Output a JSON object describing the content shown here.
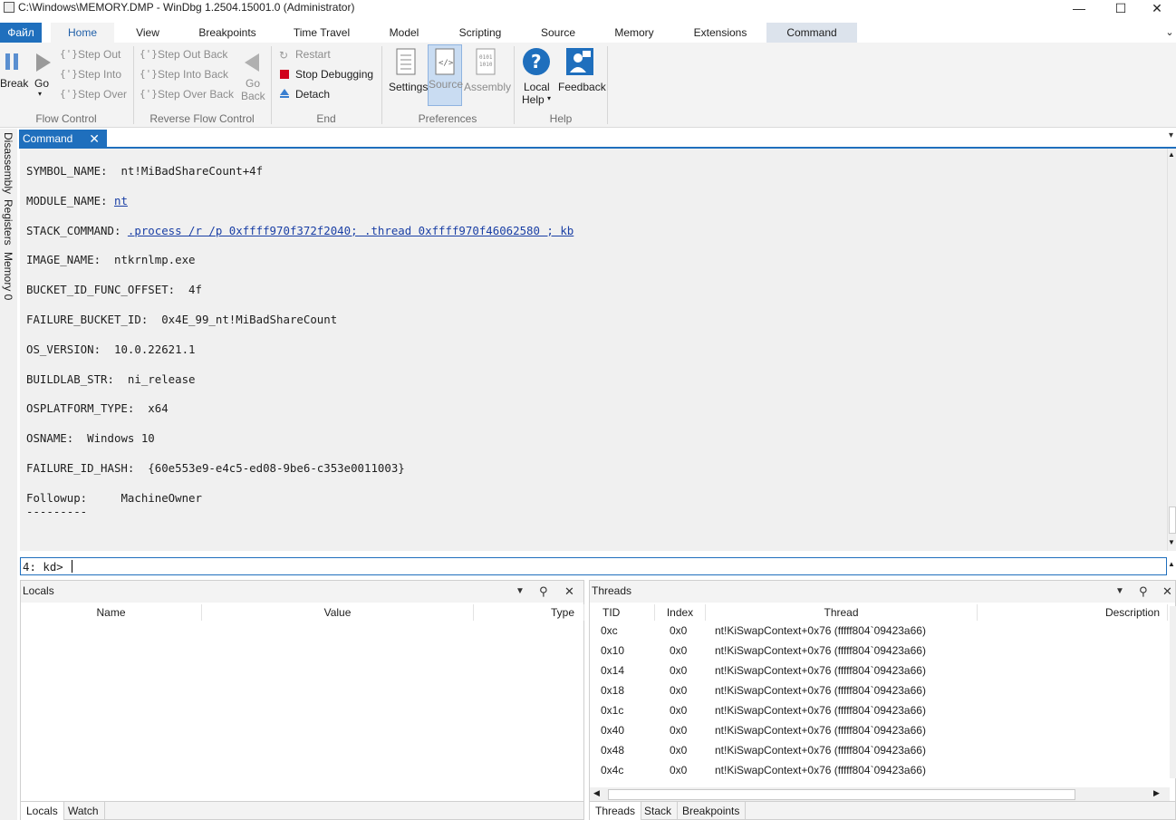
{
  "window": {
    "title": "C:\\Windows\\MEMORY.DMP - WinDbg 1.2504.15001.0 (Administrator)",
    "minimize": "—",
    "maximize": "☐",
    "close": "✕"
  },
  "tabs": [
    "Файл",
    "Home",
    "View",
    "Breakpoints",
    "Time Travel",
    "Model",
    "Scripting",
    "Source",
    "Memory",
    "Extensions",
    "Command"
  ],
  "ribbon": {
    "flow_control": {
      "label": "Flow Control",
      "break": "Break",
      "go": "Go",
      "step_out": "Step Out",
      "step_into": "Step Into",
      "step_over": "Step Over"
    },
    "reverse_flow": {
      "label": "Reverse Flow Control",
      "step_out_back": "Step Out Back",
      "step_into_back": "Step Into Back",
      "step_over_back": "Step Over Back",
      "go_back_1": "Go",
      "go_back_2": "Back"
    },
    "end": {
      "label": "End",
      "restart": "Restart",
      "stop": "Stop Debugging",
      "detach": "Detach"
    },
    "preferences": {
      "label": "Preferences",
      "settings": "Settings",
      "source": "Source",
      "assembly": "Assembly"
    },
    "help": {
      "label": "Help",
      "local_help_1": "Local",
      "local_help_2": "Help",
      "feedback": "Feedback"
    }
  },
  "rail": [
    "Disassembly",
    "Registers",
    "Memory 0"
  ],
  "command": {
    "tab_label": "Command",
    "lines": [
      {
        "k": "SYMBOL_NAME:  ",
        "v": "nt!MiBadShareCount+4f",
        "link": false
      },
      {
        "k": "MODULE_NAME: ",
        "v": "nt",
        "link": true
      },
      {
        "k": "STACK_COMMAND: ",
        "v": ".process /r /p 0xffff970f372f2040; .thread 0xffff970f46062580 ; kb",
        "link": true
      },
      {
        "k": "IMAGE_NAME:  ",
        "v": "ntkrnlmp.exe",
        "link": false
      },
      {
        "k": "BUCKET_ID_FUNC_OFFSET:  ",
        "v": "4f",
        "link": false
      },
      {
        "k": "FAILURE_BUCKET_ID:  ",
        "v": "0x4E_99_nt!MiBadShareCount",
        "link": false
      },
      {
        "k": "OS_VERSION:  ",
        "v": "10.0.22621.1",
        "link": false
      },
      {
        "k": "BUILDLAB_STR:  ",
        "v": "ni_release",
        "link": false
      },
      {
        "k": "OSPLATFORM_TYPE:  ",
        "v": "x64",
        "link": false
      },
      {
        "k": "OSNAME:  ",
        "v": "Windows 10",
        "link": false
      },
      {
        "k": "FAILURE_ID_HASH:  ",
        "v": "{60e553e9-e4c5-ed08-9be6-c353e0011003}",
        "link": false
      },
      {
        "k": "Followup:     ",
        "v": "MachineOwner",
        "link": false
      }
    ],
    "separator": "---------",
    "prompt": "4: kd>"
  },
  "locals": {
    "title": "Locals",
    "columns": [
      "Name",
      "Value",
      "Type"
    ],
    "tabs": [
      "Locals",
      "Watch"
    ]
  },
  "threads": {
    "title": "Threads",
    "columns": [
      "TID",
      "Index",
      "Thread",
      "Description"
    ],
    "rows": [
      {
        "tid": "0xc",
        "index": "0x0",
        "thread": "nt!KiSwapContext+0x76 (fffff804`09423a66)"
      },
      {
        "tid": "0x10",
        "index": "0x0",
        "thread": "nt!KiSwapContext+0x76 (fffff804`09423a66)"
      },
      {
        "tid": "0x14",
        "index": "0x0",
        "thread": "nt!KiSwapContext+0x76 (fffff804`09423a66)"
      },
      {
        "tid": "0x18",
        "index": "0x0",
        "thread": "nt!KiSwapContext+0x76 (fffff804`09423a66)"
      },
      {
        "tid": "0x1c",
        "index": "0x0",
        "thread": "nt!KiSwapContext+0x76 (fffff804`09423a66)"
      },
      {
        "tid": "0x40",
        "index": "0x0",
        "thread": "nt!KiSwapContext+0x76 (fffff804`09423a66)"
      },
      {
        "tid": "0x48",
        "index": "0x0",
        "thread": "nt!KiSwapContext+0x76 (fffff804`09423a66)"
      },
      {
        "tid": "0x4c",
        "index": "0x0",
        "thread": "nt!KiSwapContext+0x76 (fffff804`09423a66)"
      }
    ],
    "tabs": [
      "Threads",
      "Stack",
      "Breakpoints"
    ]
  },
  "colors": {
    "accent": "#1f6fbd",
    "link": "#1a3fa5",
    "stop": "#d0021b"
  }
}
